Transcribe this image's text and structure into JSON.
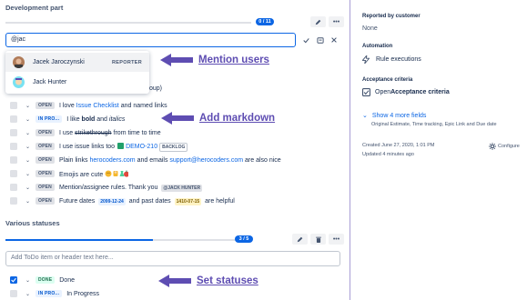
{
  "dev_section": {
    "title": "Development part",
    "progress": {
      "badge": "0 / 11",
      "fraction": 0.0
    },
    "input": {
      "value": "@jac"
    },
    "mentions": [
      {
        "name": "Jacek Jaroczynski",
        "role": "REPORTER"
      },
      {
        "name": "Jack Hunter",
        "role": ""
      }
    ],
    "hidden_tail": "oup)",
    "todos": [
      {
        "status": "OPEN",
        "parts": [
          "I love ",
          "Issue Checklist",
          " and named links"
        ]
      },
      {
        "status": "IN PRO...",
        "parts": [
          "I like ",
          "bold",
          " and ",
          "italics"
        ]
      },
      {
        "status": "OPEN",
        "parts": [
          "I use ",
          "strikethrough",
          " from time to time"
        ]
      },
      {
        "status": "OPEN",
        "parts": [
          "I use issue links too",
          "DEMO-210",
          "BACKLOG"
        ]
      },
      {
        "status": "OPEN",
        "parts": [
          "Plain links ",
          "herocoders.com",
          " and emails ",
          "support@herocoders.com",
          " are also nice"
        ]
      },
      {
        "status": "OPEN",
        "parts": [
          "Emojis are cute "
        ]
      },
      {
        "status": "OPEN",
        "parts": [
          "Mention/assignee rules. Thank you ",
          "@JACK HUNTER"
        ]
      },
      {
        "status": "OPEN",
        "parts": [
          "Future dates ",
          "2099-12-24",
          " and past dates ",
          "1410-07-15",
          " are helpful"
        ]
      }
    ]
  },
  "statuses_section": {
    "title": "Various statuses",
    "progress": {
      "badge": "3 / 5",
      "fraction": 0.6
    },
    "input": {
      "placeholder": "Add ToDo item or header text here..."
    },
    "todos": [
      {
        "status": "DONE",
        "text": "Done",
        "checked": true
      },
      {
        "status": "IN PRO...",
        "text": "In Progress",
        "checked": false
      }
    ]
  },
  "annotations": {
    "mention": "Mention users",
    "markdown": "Add markdown",
    "statuses": "Set statuses"
  },
  "sidebar": {
    "reported_by": {
      "label": "Reported by customer",
      "value": "None"
    },
    "automation": {
      "label": "Automation",
      "value": "Rule executions"
    },
    "acceptance": {
      "label": "Acceptance criteria",
      "prefix": "Open ",
      "link": "Acceptance criteria"
    },
    "more_fields": {
      "label": "Show 4 more fields",
      "sub": "Original Estimate, Time tracking, Epic Link and Due date"
    },
    "created": "Created June 27, 2020, 1:01 PM",
    "updated": "Updated 4 minutes ago",
    "configure": "Configure"
  },
  "colors": {
    "accent": "#0c66e4",
    "annotation": "#5e4db2"
  }
}
